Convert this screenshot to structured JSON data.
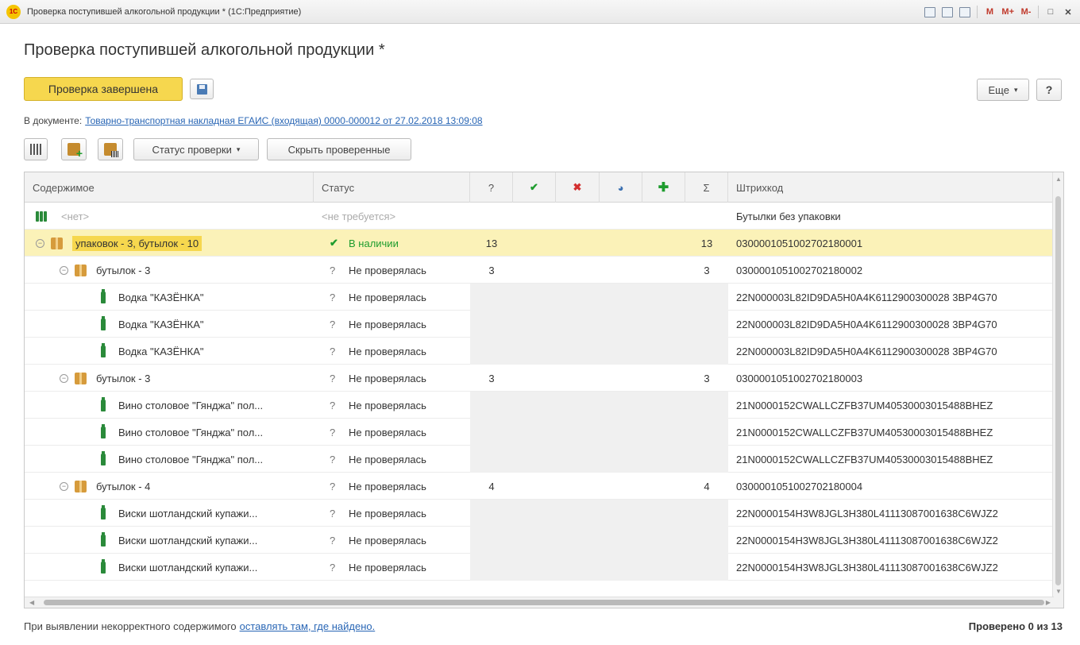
{
  "window": {
    "title": "Проверка поступившей алкогольной продукции * (1С:Предприятие)",
    "app_logo": "1С",
    "tools": [
      "M",
      "M+",
      "M-"
    ]
  },
  "form": {
    "title": "Проверка поступившей алкогольной продукции *",
    "primary_button": "Проверка завершена",
    "more_button": "Еще",
    "help_button": "?",
    "doc_label": "В документе:",
    "doc_link": "Товарно-транспортная накладная ЕГАИС (входящая) 0000-000012 от 27.02.2018 13:09:08"
  },
  "toolbar": {
    "status_button": "Статус проверки",
    "hide_button": "Скрыть проверенные"
  },
  "table": {
    "headers": {
      "content": "Содержимое",
      "status": "Статус",
      "q": "?",
      "sum": "Σ",
      "barcode": "Штрихкод"
    },
    "rows": [
      {
        "content": "<нет>",
        "status": "<не требуется>",
        "q": "",
        "sum": "",
        "barcode": "Бутылки без упаковки"
      },
      {
        "content": "упаковок - 3, бутылок -  10",
        "status": "В наличии",
        "q": "13",
        "sum": "13",
        "barcode": "030000105100270218000​1"
      },
      {
        "content": "бутылок - 3",
        "status": "Не проверялась",
        "q": "3",
        "sum": "3",
        "barcode": "0300001051002702180002"
      },
      {
        "content": "Водка \"КАЗЁНКА\"",
        "status": "Не проверялась",
        "q": "",
        "sum": "",
        "barcode": "22N000003L82ID9DA5H0A4K6112900300028 3BP4G70"
      },
      {
        "content": "Водка \"КАЗЁНКА\"",
        "status": "Не проверялась",
        "q": "",
        "sum": "",
        "barcode": "22N000003L82ID9DA5H0A4K6112900300028 3BP4G70"
      },
      {
        "content": "Водка \"КАЗЁНКА\"",
        "status": "Не проверялась",
        "q": "",
        "sum": "",
        "barcode": "22N000003L82ID9DA5H0A4K6112900300028 3BP4G70"
      },
      {
        "content": "бутылок - 3",
        "status": "Не проверялась",
        "q": "3",
        "sum": "3",
        "barcode": "0300001051002702180003"
      },
      {
        "content": "Вино столовое \"Гянджа\" пол...",
        "status": "Не проверялась",
        "q": "",
        "sum": "",
        "barcode": "21N0000152CWALLCZFB37UM40530003015488BHEZ"
      },
      {
        "content": "Вино столовое \"Гянджа\" пол...",
        "status": "Не проверялась",
        "q": "",
        "sum": "",
        "barcode": "21N0000152CWALLCZFB37UM40530003015488BHEZ"
      },
      {
        "content": "Вино столовое \"Гянджа\" пол...",
        "status": "Не проверялась",
        "q": "",
        "sum": "",
        "barcode": "21N0000152CWALLCZFB37UM40530003015488BHEZ"
      },
      {
        "content": "бутылок - 4",
        "status": "Не проверялась",
        "q": "4",
        "sum": "4",
        "barcode": "0300001051002702180004"
      },
      {
        "content": "Виски шотландский купажи...",
        "status": "Не проверялась",
        "q": "",
        "sum": "",
        "barcode": "22N0000154H3W8JGL3H380L41113087001638C6WJZ2"
      },
      {
        "content": "Виски шотландский купажи...",
        "status": "Не проверялась",
        "q": "",
        "sum": "",
        "barcode": "22N0000154H3W8JGL3H380L41113087001638C6WJZ2"
      },
      {
        "content": "Виски шотландский купажи...",
        "status": "Не проверялась",
        "q": "",
        "sum": "",
        "barcode": "22N0000154H3W8JGL3H380L41113087001638C6WJZ2"
      }
    ]
  },
  "footer": {
    "text": "При выявлении некорректного содержимого",
    "link": "оставлять там, где найдено.",
    "progress": "Проверено 0 из 13"
  },
  "colors": {
    "accent": "#f6d74e",
    "selected_row": "#fbf2b8",
    "ok": "#1e9c2e",
    "error": "#d32f2f",
    "link": "#2966b5"
  }
}
